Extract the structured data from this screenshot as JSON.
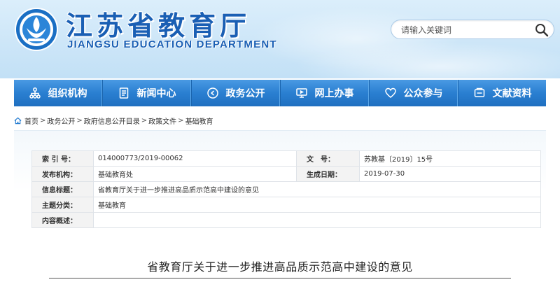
{
  "header": {
    "title": "江苏省教育厅",
    "subtitle": "JIANGSU EDUCATION DEPARTMENT",
    "logo_icon": "education-department-emblem-icon"
  },
  "search": {
    "placeholder": "请输入关键词",
    "icon": "search-icon"
  },
  "nav": {
    "items": [
      {
        "label": "组织机构",
        "icon": "org-chart-icon"
      },
      {
        "label": "新闻中心",
        "icon": "document-icon"
      },
      {
        "label": "政务公开",
        "icon": "play-circle-icon"
      },
      {
        "label": "网上办事",
        "icon": "monitor-icon"
      },
      {
        "label": "公众参与",
        "icon": "heart-icon"
      },
      {
        "label": "文献资料",
        "icon": "book-icon"
      }
    ]
  },
  "breadcrumb": {
    "items": [
      "首页",
      "政务公开",
      "政府信息公开目录",
      "政策文件",
      "基础教育"
    ],
    "separator": ">"
  },
  "meta": {
    "index_label": "索 引 号：",
    "index_value": "014000773/2019-00062",
    "docno_label": "文　号：",
    "docno_value": "苏教基〔2019〕15号",
    "org_label": "发布机构：",
    "org_value": "基础教育处",
    "date_label": "生成日期：",
    "date_value": "2019-07-30",
    "title_label": "信息标题：",
    "title_value": "省教育厅关于进一步推进高品质示范高中建设的意见",
    "category_label": "主题分类：",
    "category_value": "基础教育",
    "summary_label": "内容概述：",
    "summary_value": ""
  },
  "document": {
    "title": "省教育厅关于进一步推进高品质示范高中建设的意见"
  },
  "colors": {
    "brand_blue": "#1a5fb4",
    "nav_blue": "#2a7fd1",
    "banner_light": "#dbeefb"
  }
}
